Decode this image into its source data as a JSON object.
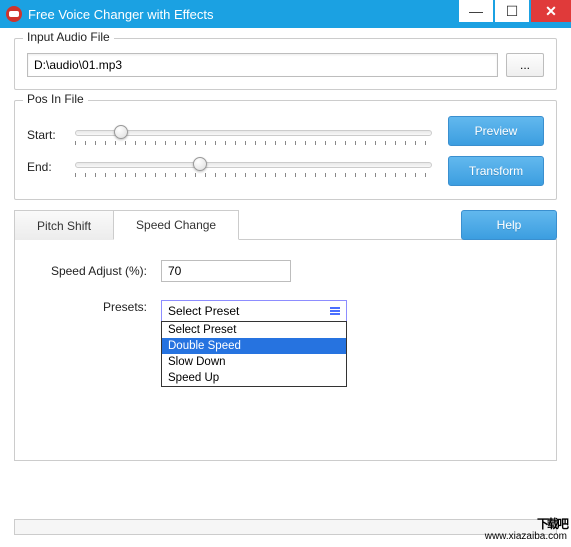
{
  "window": {
    "title": "Free Voice Changer with Effects"
  },
  "input_group": {
    "legend": "Input Audio File",
    "path": "D:\\audio\\01.mp3",
    "browse": "..."
  },
  "pos_group": {
    "legend": "Pos In File",
    "start_label": "Start:",
    "end_label": "End:",
    "start_pos_pct": 11,
    "end_pos_pct": 33,
    "preview": "Preview",
    "transform": "Transform"
  },
  "tabs": {
    "pitch": "Pitch Shift",
    "speed": "Speed Change",
    "help": "Help"
  },
  "speed": {
    "adjust_label": "Speed Adjust (%):",
    "adjust_value": "70",
    "presets_label": "Presets:",
    "preset_selected": "Select Preset",
    "options": {
      "o0": "Select Preset",
      "o1": "Double Speed",
      "o2": "Slow Down",
      "o3": "Speed Up"
    }
  },
  "watermark": {
    "big": "下载吧",
    "url": "www.xiazaiba.com"
  }
}
